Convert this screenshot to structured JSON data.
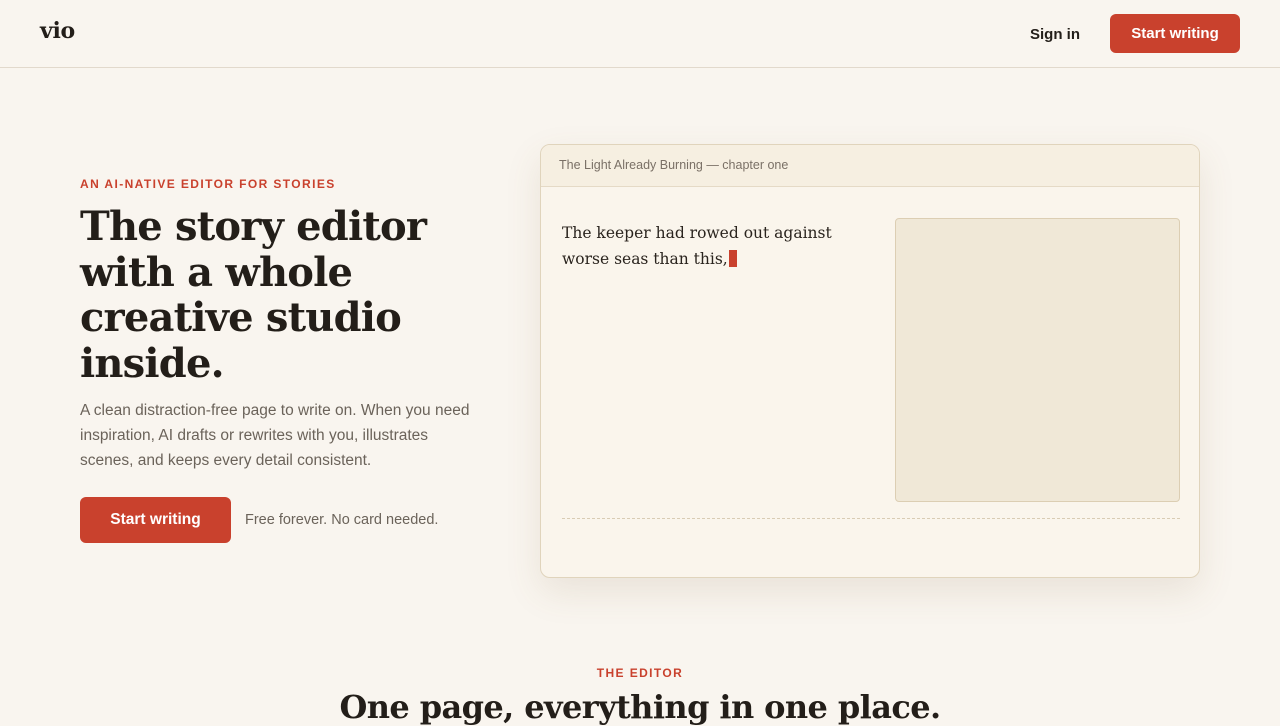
{
  "brand": {
    "logo": "vio"
  },
  "nav": {
    "sign_in": "Sign in",
    "cta": "Start writing"
  },
  "hero": {
    "eyebrow": "AN AI-NATIVE EDITOR FOR STORIES",
    "headline": "The story editor with a whole creative studio inside.",
    "subheadline": "A clean distraction-free page to write on. When you need inspiration, AI drafts or rewrites with you, illustrates scenes, and keeps every detail consistent.",
    "cta": "Start writing",
    "cta_note": "Free forever. No card needed."
  },
  "editor_preview": {
    "doc_title": "The Light Already Burning — chapter one",
    "body_text": "The keeper had rowed out against worse seas than this,"
  },
  "section": {
    "eyebrow": "THE EDITOR",
    "title": "One page, everything in one place."
  },
  "colors": {
    "accent": "#c9412d",
    "background": "#f9f5ef",
    "text": "#231e19",
    "muted": "#6b635a"
  }
}
